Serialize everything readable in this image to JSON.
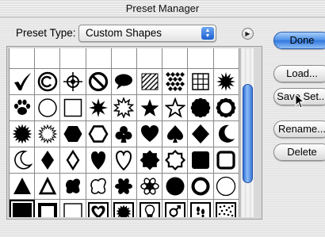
{
  "window": {
    "title": "Preset Manager"
  },
  "preset_type": {
    "label": "Preset Type:",
    "selected": "Custom Shapes"
  },
  "buttons": {
    "done": "Done",
    "load": "Load...",
    "save_set": "Save Set...",
    "rename": "Rename...",
    "delete": "Delete"
  },
  "shapes": [
    "partial",
    "partial",
    "partial",
    "partial",
    "partial",
    "partial",
    "partial",
    "partial",
    "partial",
    "checkmark",
    "copyright",
    "registration-target",
    "no-symbol",
    "speech-bubble",
    "hatched-square",
    "diamond-pattern",
    "grid-square",
    "starburst-12",
    "paw-print",
    "circle-outline",
    "square-outline",
    "starburst-8",
    "starburst-outline",
    "star-5",
    "star-5-outline",
    "scalloped-circle",
    "scalloped-ring",
    "starburst-16",
    "starburst-16-outline",
    "hexagon",
    "hexagon-outline",
    "club",
    "heart",
    "spade",
    "diamond",
    "crescent",
    "crescent-outline",
    "diamond-tall",
    "diamond-tall-outline",
    "heart-tall",
    "heart-tall-outline",
    "octagon-star",
    "octagon-star-outline",
    "rounded-square",
    "rounded-square-outline",
    "triangle",
    "triangle-outline",
    "blob",
    "blob-outline",
    "flower",
    "flower-outline",
    "circle",
    "ring",
    "circle-thin",
    "square",
    "square-frame",
    "square-thin",
    "heart-frame",
    "seal-frame",
    "bulb-frame",
    "male-female-frame",
    "footprints-frame",
    "dots-frame"
  ],
  "selected_shape": "square"
}
